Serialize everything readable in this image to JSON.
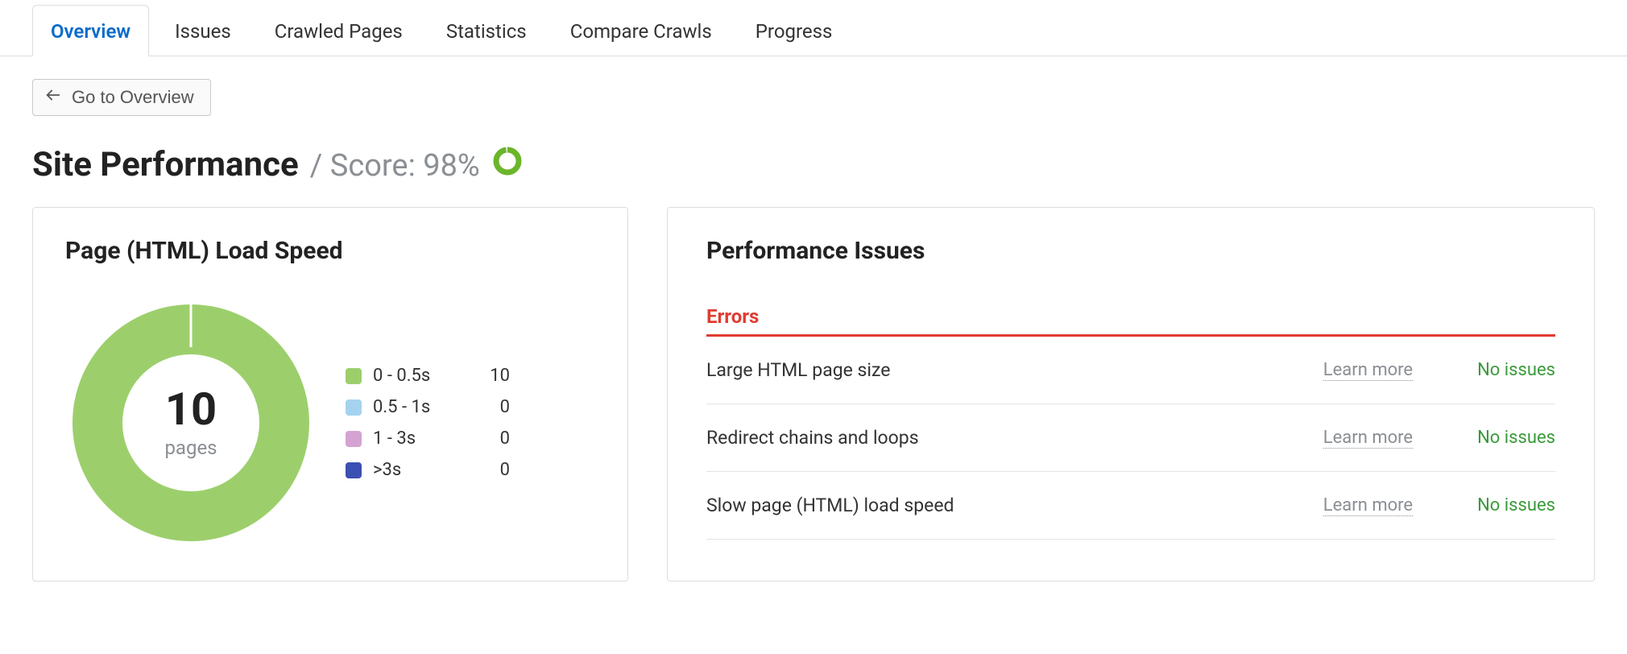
{
  "tabs": [
    {
      "label": "Overview",
      "active": true
    },
    {
      "label": "Issues",
      "active": false
    },
    {
      "label": "Crawled Pages",
      "active": false
    },
    {
      "label": "Statistics",
      "active": false
    },
    {
      "label": "Compare Crawls",
      "active": false
    },
    {
      "label": "Progress",
      "active": false
    }
  ],
  "back_button": {
    "label": "Go to Overview"
  },
  "heading": {
    "title": "Site Performance",
    "separator": "/",
    "score_prefix": "Score:",
    "score_value": "98%"
  },
  "load_speed_card": {
    "title": "Page (HTML) Load Speed",
    "center_value": "10",
    "center_label": "pages",
    "legend": [
      {
        "color": "#9ccf6c",
        "label": "0 - 0.5s",
        "value": "10"
      },
      {
        "color": "#a5d3ef",
        "label": "0.5 - 1s",
        "value": "0"
      },
      {
        "color": "#d4a3d1",
        "label": "1 - 3s",
        "value": "0"
      },
      {
        "color": "#3c4fb2",
        "label": ">3s",
        "value": "0"
      }
    ]
  },
  "issues_card": {
    "title": "Performance Issues",
    "group_label": "Errors",
    "learn_more_label": "Learn more",
    "status_ok": "No issues",
    "items": [
      {
        "name": "Large HTML page size"
      },
      {
        "name": "Redirect chains and loops"
      },
      {
        "name": "Slow page (HTML) load speed"
      }
    ]
  },
  "chart_data": {
    "type": "pie",
    "title": "Page (HTML) Load Speed",
    "categories": [
      "0 - 0.5s",
      "0.5 - 1s",
      "1 - 3s",
      ">3s"
    ],
    "values": [
      10,
      0,
      0,
      0
    ],
    "colors": [
      "#9ccf6c",
      "#a5d3ef",
      "#d4a3d1",
      "#3c4fb2"
    ],
    "total": 10,
    "total_label": "pages"
  }
}
